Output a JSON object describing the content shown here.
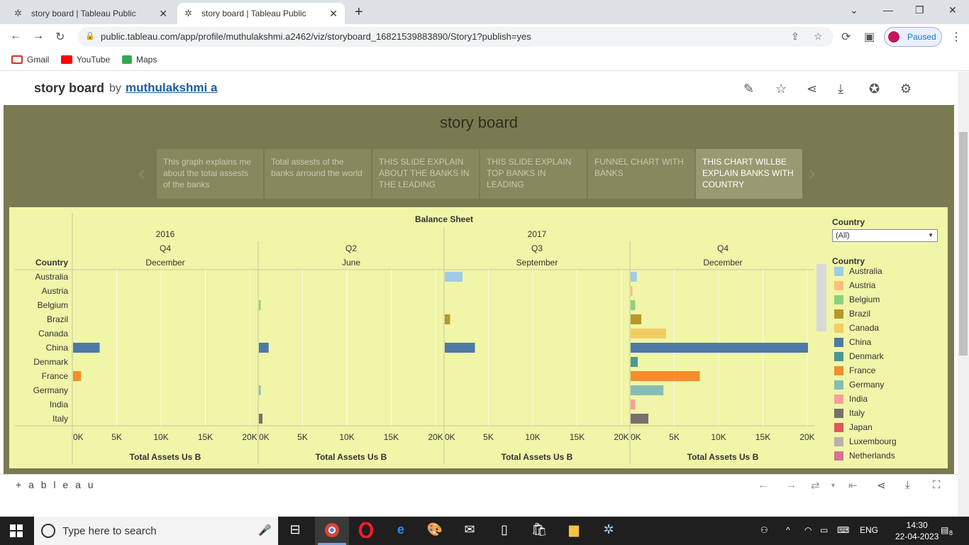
{
  "browser": {
    "tabs": [
      {
        "title": "story board | Tableau Public"
      },
      {
        "title": "story board | Tableau Public"
      }
    ],
    "url": "public.tableau.com/app/profile/muthulakshmi.a2462/viz/storyboard_16821539883890/Story1?publish=yes",
    "profile_status": "Paused",
    "bookmarks": [
      "Gmail",
      "YouTube",
      "Maps"
    ]
  },
  "page": {
    "viz_title": "story board",
    "by": "by",
    "author": "muthulakshmi a"
  },
  "story": {
    "title": "story board",
    "points": [
      "This graph explains me about the total assests of the banks",
      "Total assests of the banks arround the world",
      "THIS SLIDE EXPLAIN ABOUT THE BANKS IN THE LEADING",
      "THIS SLIDE EXPLAIN TOP BANKS IN LEADING",
      "FUNNEL CHART WITH BANKS",
      "THIS CHART WILLBE EXPLAIN BANKS WITH COUNTRY"
    ],
    "active_point": 5
  },
  "filter": {
    "label": "Country",
    "value": "(All)"
  },
  "legend": {
    "title": "Country",
    "items": [
      {
        "name": "Australia",
        "color": "#a0cbe8"
      },
      {
        "name": "Austria",
        "color": "#ffbe7d"
      },
      {
        "name": "Belgium",
        "color": "#8cd17d"
      },
      {
        "name": "Brazil",
        "color": "#b6992d"
      },
      {
        "name": "Canada",
        "color": "#f1ce63"
      },
      {
        "name": "China",
        "color": "#4e79a7"
      },
      {
        "name": "Denmark",
        "color": "#499894"
      },
      {
        "name": "France",
        "color": "#f28e2b"
      },
      {
        "name": "Germany",
        "color": "#86bcb6"
      },
      {
        "name": "India",
        "color": "#ff9d9a"
      },
      {
        "name": "Italy",
        "color": "#79706e"
      },
      {
        "name": "Japan",
        "color": "#e15759"
      },
      {
        "name": "Luxembourg",
        "color": "#bab0ac"
      },
      {
        "name": "Netherlands",
        "color": "#d37295"
      }
    ]
  },
  "chart_data": {
    "type": "bar",
    "title": "Balance Sheet",
    "row_header": "Country",
    "categories": [
      "Australia",
      "Austria",
      "Belgium",
      "Brazil",
      "Canada",
      "China",
      "Denmark",
      "France",
      "Germany",
      "India",
      "Italy"
    ],
    "xlabel": "Total Assets Us B",
    "xlim": [
      0,
      20000
    ],
    "xticks": [
      "0K",
      "5K",
      "10K",
      "15K",
      "20K"
    ],
    "panels": [
      {
        "year": "2016",
        "quarter": "Q4",
        "month": "December",
        "values": [
          0,
          0,
          0,
          0,
          0,
          3000,
          0,
          900,
          0,
          0,
          0
        ]
      },
      {
        "year": "",
        "quarter": "Q2",
        "month": "June",
        "values": [
          0,
          0,
          200,
          0,
          0,
          1100,
          0,
          0,
          200,
          0,
          400
        ]
      },
      {
        "year": "2017",
        "quarter": "Q3",
        "month": "September",
        "values": [
          2000,
          0,
          0,
          600,
          0,
          3400,
          0,
          0,
          0,
          0,
          0
        ]
      },
      {
        "year": "",
        "quarter": "Q4",
        "month": "December",
        "values": [
          700,
          200,
          500,
          1200,
          4000,
          20000,
          800,
          7800,
          3700,
          500,
          2000
        ]
      }
    ]
  },
  "taskbar": {
    "search_placeholder": "Type here to search",
    "lang": "ENG",
    "time": "14:30",
    "date": "22-04-2023",
    "notif_count": "8"
  },
  "footer": {
    "logo": "+ a b l e a u"
  }
}
